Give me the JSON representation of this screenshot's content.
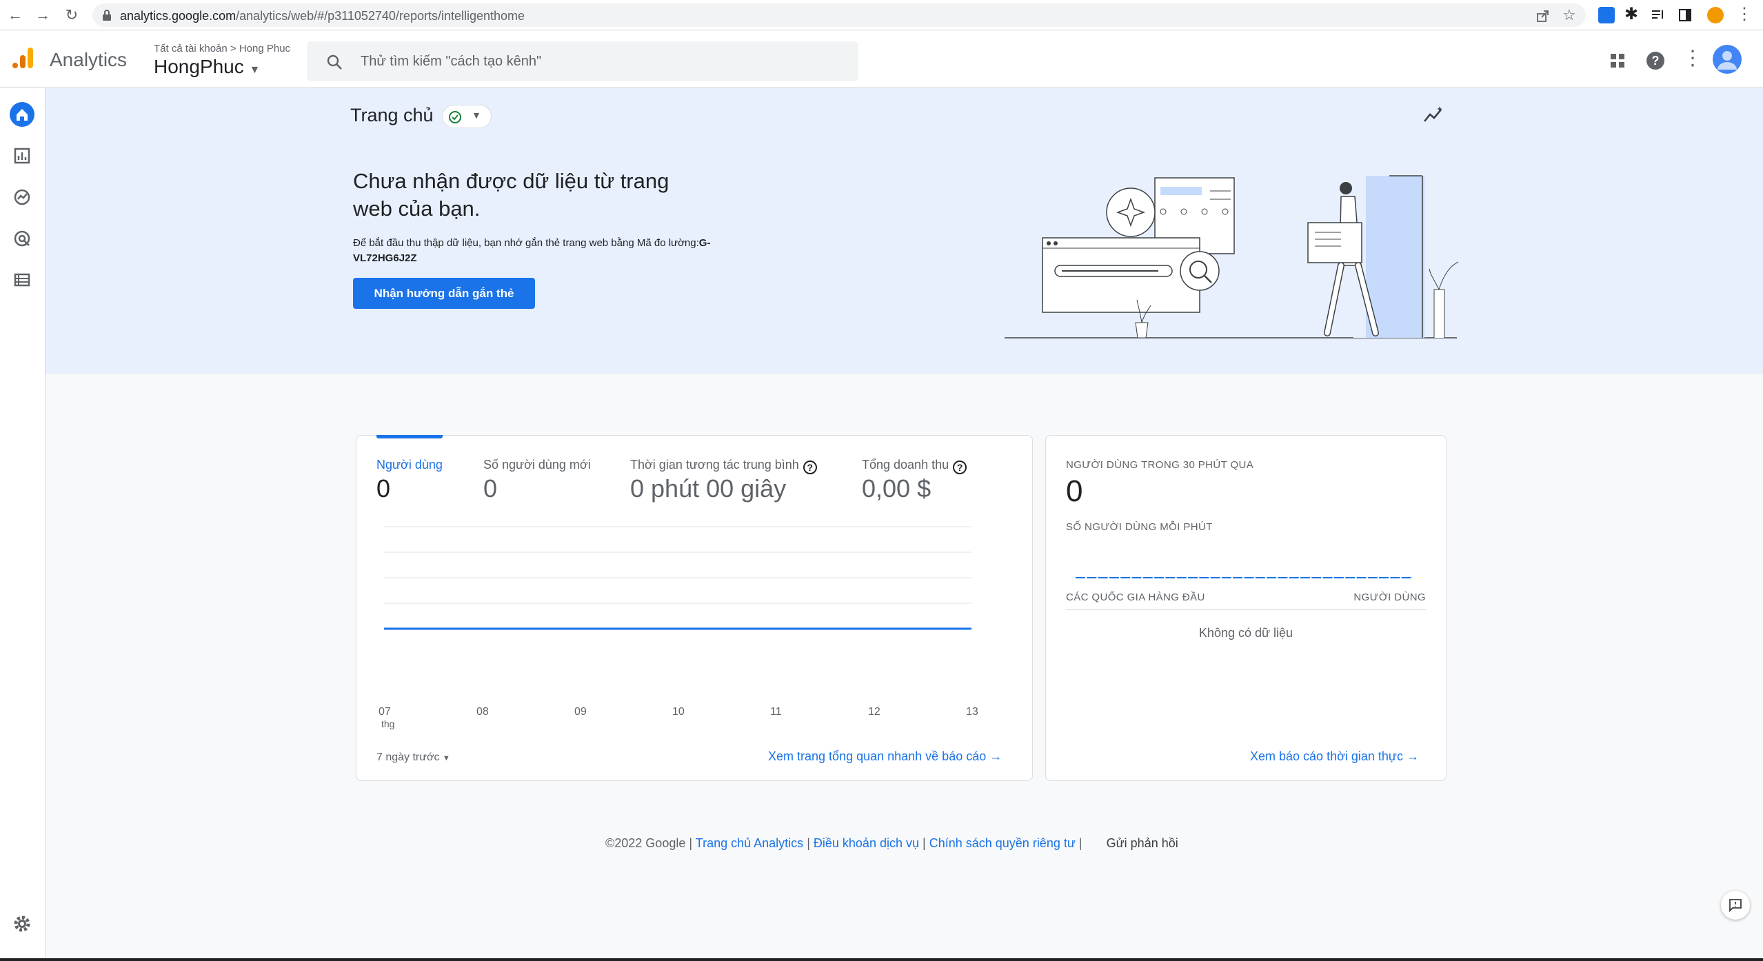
{
  "browser": {
    "url_host": "analytics.google.com",
    "url_path": "/analytics/web/#/p311052740/reports/intelligenthome"
  },
  "header": {
    "app_name": "Analytics",
    "breadcrumb_all": "Tất cả tài khoản",
    "breadcrumb_sep": ">",
    "breadcrumb_account": "Hong Phuc",
    "property_name": "HongPhuc",
    "search_placeholder": "Thử tìm kiếm \"cách tạo kênh\""
  },
  "page": {
    "title": "Trang chủ"
  },
  "hero": {
    "heading": "Chưa nhận được dữ liệu từ trang web của bạn.",
    "body_text": "Để bắt đầu thu thập dữ liệu, bạn nhớ gắn thẻ trang web bằng Mã đo lường:",
    "measurement_id": "G-VL72HG6J2Z",
    "button_label": "Nhận hướng dẫn gắn thẻ"
  },
  "overview_card": {
    "metrics": [
      {
        "label": "Người dùng",
        "value": "0"
      },
      {
        "label": "Số người dùng mới",
        "value": "0"
      },
      {
        "label": "Thời gian tương tác trung bình",
        "value": "0 phút 00 giây"
      },
      {
        "label": "Tổng doanh thu",
        "value": "0,00 $"
      }
    ],
    "x_ticks": [
      "07",
      "08",
      "09",
      "10",
      "11",
      "12",
      "13"
    ],
    "x_month": "thg",
    "range_label": "7 ngày trước",
    "link_label": "Xem trang tổng quan nhanh về báo cáo"
  },
  "realtime_card": {
    "title": "NGƯỜI DÙNG TRONG 30 PHÚT QUA",
    "value": "0",
    "per_minute_label": "SỐ NGƯỜI DÙNG MỖI PHÚT",
    "countries_header": "CÁC QUỐC GIA HÀNG ĐẦU",
    "users_header": "NGƯỜI DÙNG",
    "no_data": "Không có dữ liệu",
    "link_label": "Xem báo cáo thời gian thực"
  },
  "footer": {
    "copyright": "©2022 Google",
    "sep": "|",
    "link_home": "Trang chủ Analytics",
    "link_terms": "Điều khoản dịch vụ",
    "link_privacy": "Chính sách quyền riêng tư",
    "feedback": "Gửi phản hồi"
  },
  "chart_data": {
    "type": "line",
    "x": [
      "07",
      "08",
      "09",
      "10",
      "11",
      "12",
      "13"
    ],
    "series": [
      {
        "name": "Người dùng",
        "values": [
          0,
          0,
          0,
          0,
          0,
          0,
          0
        ]
      }
    ],
    "xlabel": "thg",
    "grid": true
  },
  "colors": {
    "accent": "#1a73e8",
    "hero_bg": "#e8f0fe"
  }
}
